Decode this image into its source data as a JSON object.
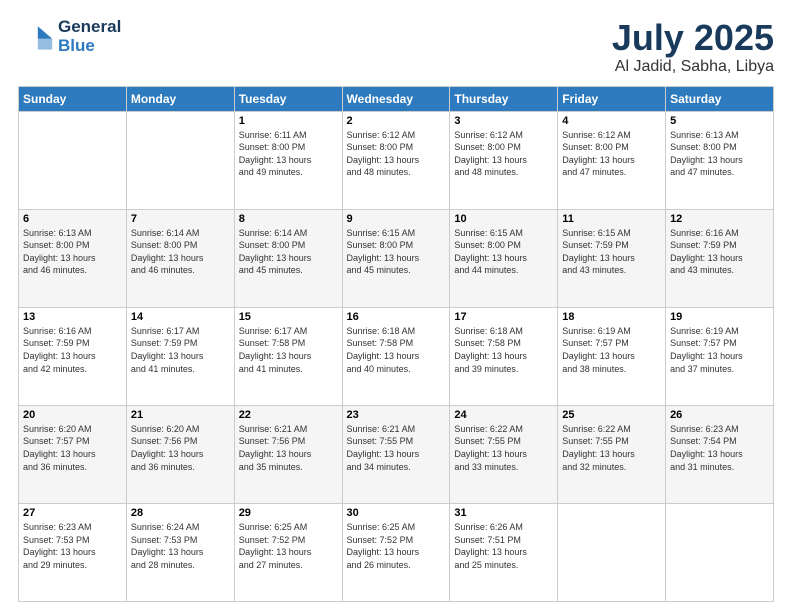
{
  "header": {
    "logo_line1": "General",
    "logo_line2": "Blue",
    "title": "July 2025",
    "subtitle": "Al Jadid, Sabha, Libya"
  },
  "days_of_week": [
    "Sunday",
    "Monday",
    "Tuesday",
    "Wednesday",
    "Thursday",
    "Friday",
    "Saturday"
  ],
  "weeks": [
    [
      {
        "day": "",
        "info": ""
      },
      {
        "day": "",
        "info": ""
      },
      {
        "day": "1",
        "info": "Sunrise: 6:11 AM\nSunset: 8:00 PM\nDaylight: 13 hours\nand 49 minutes."
      },
      {
        "day": "2",
        "info": "Sunrise: 6:12 AM\nSunset: 8:00 PM\nDaylight: 13 hours\nand 48 minutes."
      },
      {
        "day": "3",
        "info": "Sunrise: 6:12 AM\nSunset: 8:00 PM\nDaylight: 13 hours\nand 48 minutes."
      },
      {
        "day": "4",
        "info": "Sunrise: 6:12 AM\nSunset: 8:00 PM\nDaylight: 13 hours\nand 47 minutes."
      },
      {
        "day": "5",
        "info": "Sunrise: 6:13 AM\nSunset: 8:00 PM\nDaylight: 13 hours\nand 47 minutes."
      }
    ],
    [
      {
        "day": "6",
        "info": "Sunrise: 6:13 AM\nSunset: 8:00 PM\nDaylight: 13 hours\nand 46 minutes."
      },
      {
        "day": "7",
        "info": "Sunrise: 6:14 AM\nSunset: 8:00 PM\nDaylight: 13 hours\nand 46 minutes."
      },
      {
        "day": "8",
        "info": "Sunrise: 6:14 AM\nSunset: 8:00 PM\nDaylight: 13 hours\nand 45 minutes."
      },
      {
        "day": "9",
        "info": "Sunrise: 6:15 AM\nSunset: 8:00 PM\nDaylight: 13 hours\nand 45 minutes."
      },
      {
        "day": "10",
        "info": "Sunrise: 6:15 AM\nSunset: 8:00 PM\nDaylight: 13 hours\nand 44 minutes."
      },
      {
        "day": "11",
        "info": "Sunrise: 6:15 AM\nSunset: 7:59 PM\nDaylight: 13 hours\nand 43 minutes."
      },
      {
        "day": "12",
        "info": "Sunrise: 6:16 AM\nSunset: 7:59 PM\nDaylight: 13 hours\nand 43 minutes."
      }
    ],
    [
      {
        "day": "13",
        "info": "Sunrise: 6:16 AM\nSunset: 7:59 PM\nDaylight: 13 hours\nand 42 minutes."
      },
      {
        "day": "14",
        "info": "Sunrise: 6:17 AM\nSunset: 7:59 PM\nDaylight: 13 hours\nand 41 minutes."
      },
      {
        "day": "15",
        "info": "Sunrise: 6:17 AM\nSunset: 7:58 PM\nDaylight: 13 hours\nand 41 minutes."
      },
      {
        "day": "16",
        "info": "Sunrise: 6:18 AM\nSunset: 7:58 PM\nDaylight: 13 hours\nand 40 minutes."
      },
      {
        "day": "17",
        "info": "Sunrise: 6:18 AM\nSunset: 7:58 PM\nDaylight: 13 hours\nand 39 minutes."
      },
      {
        "day": "18",
        "info": "Sunrise: 6:19 AM\nSunset: 7:57 PM\nDaylight: 13 hours\nand 38 minutes."
      },
      {
        "day": "19",
        "info": "Sunrise: 6:19 AM\nSunset: 7:57 PM\nDaylight: 13 hours\nand 37 minutes."
      }
    ],
    [
      {
        "day": "20",
        "info": "Sunrise: 6:20 AM\nSunset: 7:57 PM\nDaylight: 13 hours\nand 36 minutes."
      },
      {
        "day": "21",
        "info": "Sunrise: 6:20 AM\nSunset: 7:56 PM\nDaylight: 13 hours\nand 36 minutes."
      },
      {
        "day": "22",
        "info": "Sunrise: 6:21 AM\nSunset: 7:56 PM\nDaylight: 13 hours\nand 35 minutes."
      },
      {
        "day": "23",
        "info": "Sunrise: 6:21 AM\nSunset: 7:55 PM\nDaylight: 13 hours\nand 34 minutes."
      },
      {
        "day": "24",
        "info": "Sunrise: 6:22 AM\nSunset: 7:55 PM\nDaylight: 13 hours\nand 33 minutes."
      },
      {
        "day": "25",
        "info": "Sunrise: 6:22 AM\nSunset: 7:55 PM\nDaylight: 13 hours\nand 32 minutes."
      },
      {
        "day": "26",
        "info": "Sunrise: 6:23 AM\nSunset: 7:54 PM\nDaylight: 13 hours\nand 31 minutes."
      }
    ],
    [
      {
        "day": "27",
        "info": "Sunrise: 6:23 AM\nSunset: 7:53 PM\nDaylight: 13 hours\nand 29 minutes."
      },
      {
        "day": "28",
        "info": "Sunrise: 6:24 AM\nSunset: 7:53 PM\nDaylight: 13 hours\nand 28 minutes."
      },
      {
        "day": "29",
        "info": "Sunrise: 6:25 AM\nSunset: 7:52 PM\nDaylight: 13 hours\nand 27 minutes."
      },
      {
        "day": "30",
        "info": "Sunrise: 6:25 AM\nSunset: 7:52 PM\nDaylight: 13 hours\nand 26 minutes."
      },
      {
        "day": "31",
        "info": "Sunrise: 6:26 AM\nSunset: 7:51 PM\nDaylight: 13 hours\nand 25 minutes."
      },
      {
        "day": "",
        "info": ""
      },
      {
        "day": "",
        "info": ""
      }
    ]
  ]
}
